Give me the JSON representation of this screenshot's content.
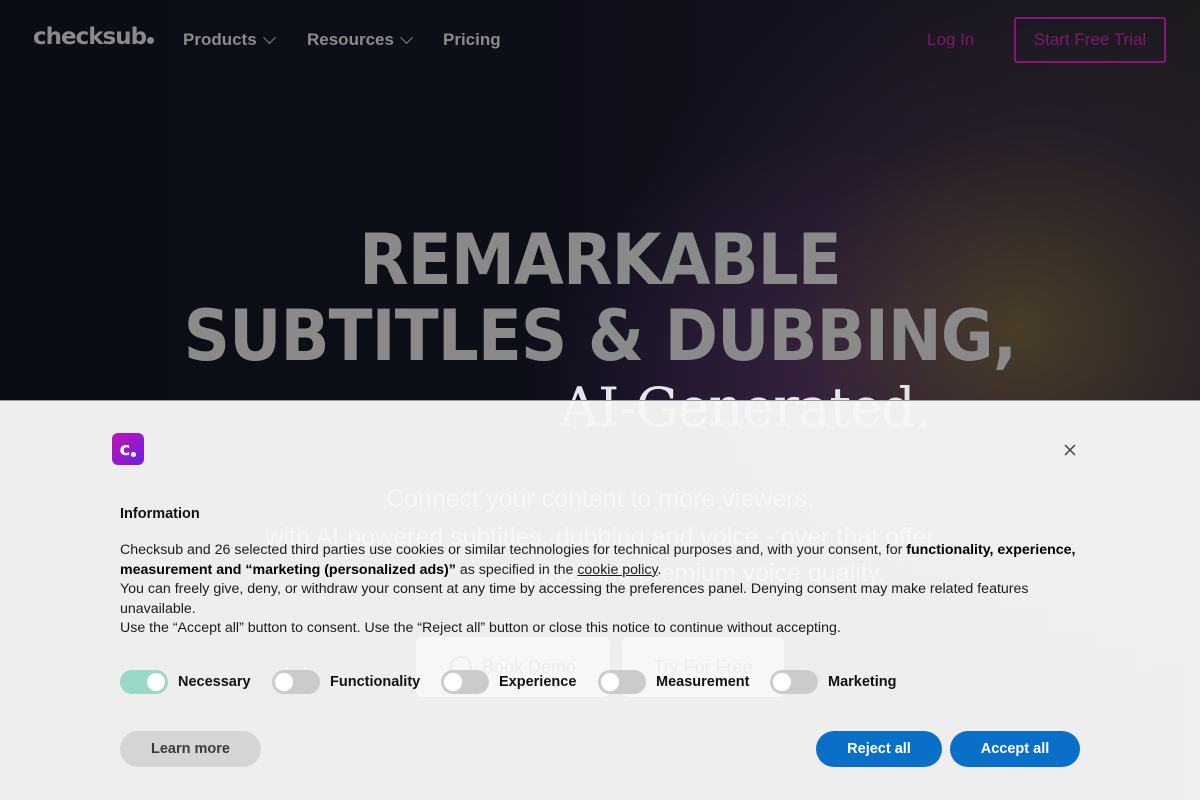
{
  "nav": {
    "logo": "checksub",
    "items": [
      {
        "label": "Products",
        "has_dropdown": true
      },
      {
        "label": "Resources",
        "has_dropdown": true
      },
      {
        "label": "Pricing",
        "has_dropdown": false
      }
    ],
    "login_label": "Log In",
    "trial_label": "Start Free Trial"
  },
  "hero": {
    "headline_line1": "REMARKABLE",
    "headline_line2": "SUBTITLES & DUBBING,",
    "subhead": "AI-Generated.",
    "tagline_line1": "Connect your content to more viewers,",
    "tagline_line2": "with AI-powered subtitles, dubbing and voice - over that offer",
    "tagline_line3": "speed and premium voice quality.",
    "book_demo_label": "Book Demo",
    "try_free_label": "Try For Free"
  },
  "cookie_banner": {
    "brand_icon": "checksub-c-logo",
    "close_icon": "close-icon",
    "title": "Information",
    "body": {
      "p1_start": "Checksub and 26 selected third parties use cookies or similar technologies for technical purposes and, with your consent, for ",
      "p1_bold": "functionality, experience, measurement and “marketing (personalized ads)”",
      "p1_mid": " as specified in the ",
      "p1_link": "cookie policy",
      "p1_end": ".",
      "p2": "You can freely give, deny, or withdraw your consent at any time by accessing the preferences panel. Denying consent may make related features unavailable.",
      "p3": "Use the “Accept all” button to consent. Use the “Reject all” button or close this notice to continue without accepting."
    },
    "toggles": [
      {
        "label": "Necessary",
        "on": true
      },
      {
        "label": "Functionality",
        "on": false
      },
      {
        "label": "Experience",
        "on": false
      },
      {
        "label": "Measurement",
        "on": false
      },
      {
        "label": "Marketing",
        "on": false
      }
    ],
    "learn_more_label": "Learn more",
    "reject_label": "Reject all",
    "accept_label": "Accept all"
  },
  "colors": {
    "brand_magenta": "#8a1478",
    "button_blue": "#0a6fc8",
    "toggle_on": "#9ad8c8",
    "toggle_off": "#cbcbcd"
  }
}
